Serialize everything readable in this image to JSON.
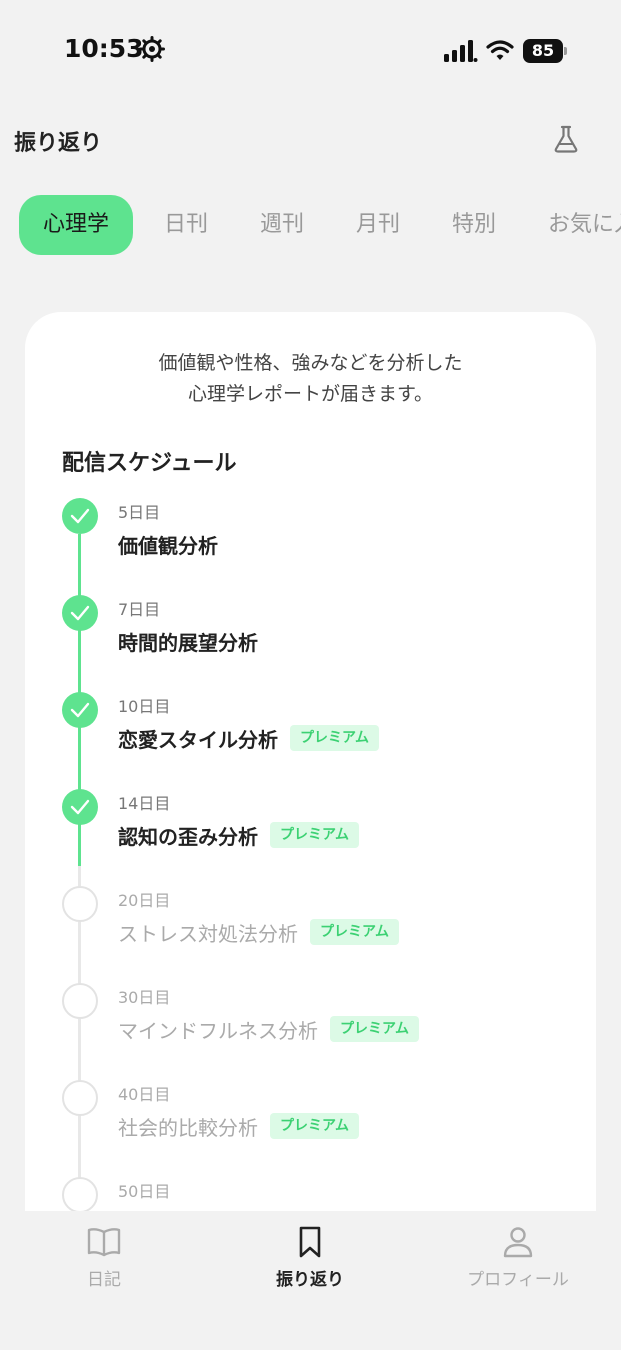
{
  "status_bar": {
    "time": "10:53",
    "battery": "85",
    "icons": [
      "gear-icon",
      "signal-icon",
      "wifi-icon",
      "battery-icon"
    ]
  },
  "header": {
    "title": "振り返り",
    "action_icon": "flask-icon"
  },
  "tabs": [
    {
      "label": "心理学",
      "active": true
    },
    {
      "label": "日刊",
      "active": false
    },
    {
      "label": "週刊",
      "active": false
    },
    {
      "label": "月刊",
      "active": false
    },
    {
      "label": "特別",
      "active": false
    },
    {
      "label": "お気に入",
      "active": false
    }
  ],
  "card": {
    "description_line1": "価値観や性格、強みなどを分析した",
    "description_line2": "心理学レポートが届きます。",
    "schedule_title": "配信スケジュール",
    "items": [
      {
        "day": "5日目",
        "title": "価値観分析",
        "badge": "",
        "done": true
      },
      {
        "day": "7日目",
        "title": "時間的展望分析",
        "badge": "",
        "done": true
      },
      {
        "day": "10日目",
        "title": "恋愛スタイル分析",
        "badge": "プレミアム",
        "done": true
      },
      {
        "day": "14日目",
        "title": "認知の歪み分析",
        "badge": "プレミアム",
        "done": true
      },
      {
        "day": "20日目",
        "title": "ストレス対処法分析",
        "badge": "プレミアム",
        "done": false
      },
      {
        "day": "30日目",
        "title": "マインドフルネス分析",
        "badge": "プレミアム",
        "done": false
      },
      {
        "day": "40日目",
        "title": "社会的比較分析",
        "badge": "プレミアム",
        "done": false
      },
      {
        "day": "50日目",
        "title": "",
        "badge": "",
        "done": false
      }
    ]
  },
  "bottom_nav": [
    {
      "label": "日記",
      "icon": "book-icon",
      "active": false
    },
    {
      "label": "振り返り",
      "icon": "bookmark-icon",
      "active": true
    },
    {
      "label": "プロフィール",
      "icon": "person-icon",
      "active": false
    }
  ],
  "colors": {
    "accent": "#5ee38f",
    "badge_bg": "#dcfae6",
    "badge_text": "#3cd173",
    "background": "#f2f2f2"
  }
}
